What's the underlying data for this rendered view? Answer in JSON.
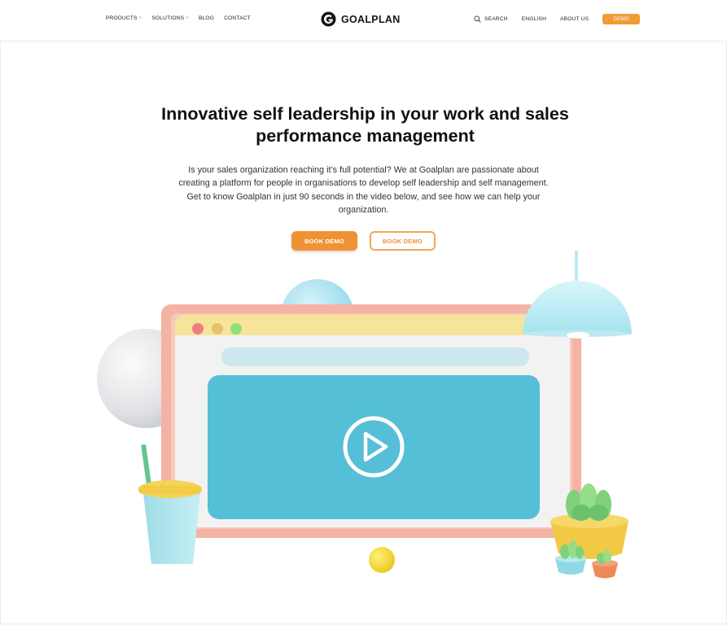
{
  "nav": {
    "left": [
      {
        "label": "PRODUCTS",
        "has_dropdown": true
      },
      {
        "label": "SOLUTIONS",
        "has_dropdown": true
      },
      {
        "label": "BLOG",
        "has_dropdown": false
      },
      {
        "label": "CONTACT",
        "has_dropdown": false
      }
    ],
    "dropdown_glyph": "˅",
    "logo_text": "GOALPLAN",
    "search_label": "SEARCH",
    "language_label": "ENGLISH",
    "about_label": "ABOUT US",
    "demo_label": "DEMO"
  },
  "hero": {
    "title": "Innovative self leadership in your work and sales performance management",
    "description": "Is your sales organization reaching it’s full potential? We at Goalplan are passionate about creating a platform for people in organisations to develop self leadership and self management. Get to know Goalplan in just 90 seconds in the video below, and see how we can help your organization.",
    "primary_button": "BOOK DEMO",
    "secondary_button": "BOOK DEMO"
  },
  "colors": {
    "accent": "#ef9233",
    "video_panel": "#55bfd8",
    "browser_bar": "#f6e49a",
    "frame_pink": "#f4b3a4"
  },
  "icons": [
    "logo-icon",
    "search-icon",
    "chevron-down-icon",
    "play-icon"
  ]
}
